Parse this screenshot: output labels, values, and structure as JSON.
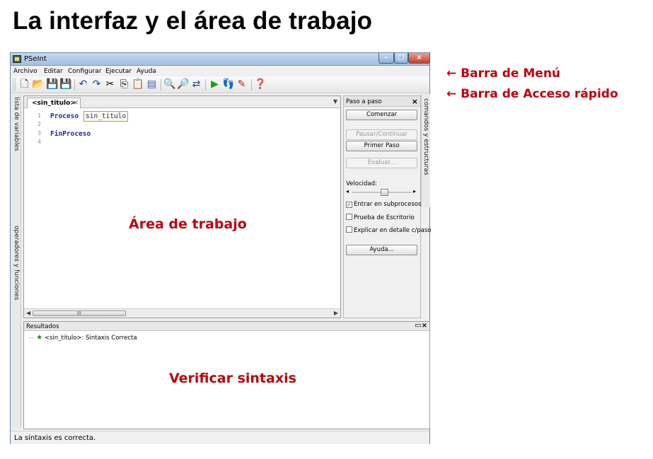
{
  "slide": {
    "title": "La interfaz y el área de trabajo"
  },
  "window": {
    "title": "PSeInt",
    "menu": [
      "Archivo",
      "Editar",
      "Configurar",
      "Ejecutar",
      "Ayuda"
    ],
    "toolbar_icons": [
      "new-file-icon",
      "open-folder-icon",
      "save-icon",
      "save-as-icon",
      "undo-icon",
      "redo-icon",
      "cut-icon",
      "copy-icon",
      "paste-icon",
      "edit-flow-icon",
      "find-icon",
      "find-next-icon",
      "replace-icon",
      "run-icon",
      "step-icon",
      "debug-icon",
      "help-icon"
    ],
    "left_tabs": {
      "variables": "lista de variables",
      "operators": "operadores y funciones"
    },
    "editor": {
      "tab_label": "<sin_titulo>",
      "tab_close": "×",
      "lines": [
        {
          "num": "1",
          "keyword": "Proceso",
          "ident": "sin_titulo"
        },
        {
          "num": "2",
          "keyword": "",
          "ident": ""
        },
        {
          "num": "3",
          "keyword": "FinProceso",
          "ident": ""
        },
        {
          "num": "4",
          "keyword": "",
          "ident": ""
        }
      ],
      "scroll_grip": "III"
    },
    "step_panel": {
      "title": "Paso a paso",
      "start": "Comenzar",
      "pause": "Pausar/Continuar",
      "first_step": "Primer Paso",
      "evaluate": "Evaluar...",
      "speed_label": "Velocidad:",
      "speed_level": 0.55,
      "enter_subprocesses": {
        "label": "Entrar en subprocesos",
        "checked": true
      },
      "desk_check": {
        "label": "Prueba de Escritorio",
        "checked": false
      },
      "explain_detail": {
        "label": "Explicar en detalle c/paso",
        "checked": false
      },
      "help": "Ayuda..."
    },
    "right_tab": "comandos y estructuras",
    "results": {
      "title": "Resultados",
      "row": "<sin_titulo>: Sintaxis Correcta"
    },
    "status": "La sintaxis es correcta."
  },
  "annotations": {
    "work_area": "Área de trabajo",
    "verify_syntax": "Verificar sintaxis",
    "menu_bar": "← Barra de Menú",
    "quick_bar": "← Barra de Acceso rápido"
  },
  "colors": {
    "annotation": "#c0000c",
    "keyword": "#1c2a9c"
  }
}
